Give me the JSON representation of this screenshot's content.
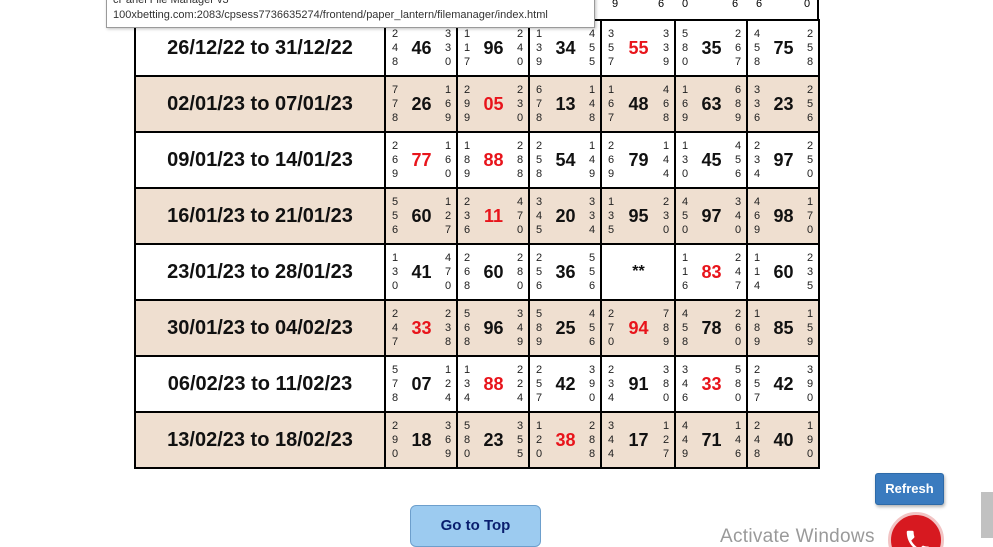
{
  "tooltip": {
    "title": "cPanel File Manager v3",
    "url": "100xbetting.com:2083/cpsess7736635274/frontend/paper_lantern/filemanager/index.html"
  },
  "top_partial": [
    "9",
    "6",
    "0",
    "6",
    "6",
    "0"
  ],
  "rows": [
    {
      "date": "26/12/22 to 31/12/22",
      "cells": [
        {
          "l": [
            "2",
            "4",
            "8"
          ],
          "j": "46",
          "r": [
            "3",
            "3",
            "0"
          ],
          "red": false
        },
        {
          "l": [
            "1",
            "1",
            "7"
          ],
          "j": "96",
          "r": [
            "2",
            "4",
            "0"
          ],
          "red": false
        },
        {
          "l": [
            "1",
            "3",
            "9"
          ],
          "j": "34",
          "r": [
            "4",
            "5",
            "5"
          ],
          "red": false
        },
        {
          "l": [
            "3",
            "5",
            "7"
          ],
          "j": "55",
          "r": [
            "3",
            "3",
            "9"
          ],
          "red": true
        },
        {
          "l": [
            "5",
            "8",
            "0"
          ],
          "j": "35",
          "r": [
            "2",
            "6",
            "7"
          ],
          "red": false
        },
        {
          "l": [
            "4",
            "5",
            "8"
          ],
          "j": "75",
          "r": [
            "2",
            "5",
            "8"
          ],
          "red": false
        }
      ]
    },
    {
      "date": "02/01/23 to 07/01/23",
      "cells": [
        {
          "l": [
            "7",
            "7",
            "8"
          ],
          "j": "26",
          "r": [
            "1",
            "6",
            "9"
          ],
          "red": false
        },
        {
          "l": [
            "2",
            "9",
            "9"
          ],
          "j": "05",
          "r": [
            "2",
            "3",
            "0"
          ],
          "red": true
        },
        {
          "l": [
            "6",
            "7",
            "8"
          ],
          "j": "13",
          "r": [
            "1",
            "4",
            "8"
          ],
          "red": false
        },
        {
          "l": [
            "1",
            "6",
            "7"
          ],
          "j": "48",
          "r": [
            "4",
            "6",
            "8"
          ],
          "red": false
        },
        {
          "l": [
            "1",
            "6",
            "9"
          ],
          "j": "63",
          "r": [
            "6",
            "8",
            "9"
          ],
          "red": false
        },
        {
          "l": [
            "3",
            "3",
            "6"
          ],
          "j": "23",
          "r": [
            "2",
            "5",
            "6"
          ],
          "red": false
        }
      ]
    },
    {
      "date": "09/01/23 to 14/01/23",
      "cells": [
        {
          "l": [
            "2",
            "6",
            "9"
          ],
          "j": "77",
          "r": [
            "1",
            "6",
            "0"
          ],
          "red": true
        },
        {
          "l": [
            "1",
            "8",
            "9"
          ],
          "j": "88",
          "r": [
            "2",
            "8",
            "8"
          ],
          "red": true
        },
        {
          "l": [
            "2",
            "5",
            "8"
          ],
          "j": "54",
          "r": [
            "1",
            "4",
            "9"
          ],
          "red": false
        },
        {
          "l": [
            "2",
            "6",
            "9"
          ],
          "j": "79",
          "r": [
            "1",
            "4",
            "4"
          ],
          "red": false
        },
        {
          "l": [
            "1",
            "3",
            "0"
          ],
          "j": "45",
          "r": [
            "4",
            "5",
            "6"
          ],
          "red": false
        },
        {
          "l": [
            "2",
            "3",
            "4"
          ],
          "j": "97",
          "r": [
            "2",
            "5",
            "0"
          ],
          "red": false
        }
      ]
    },
    {
      "date": "16/01/23 to 21/01/23",
      "cells": [
        {
          "l": [
            "5",
            "5",
            "6"
          ],
          "j": "60",
          "r": [
            "1",
            "2",
            "7"
          ],
          "red": false
        },
        {
          "l": [
            "2",
            "3",
            "6"
          ],
          "j": "11",
          "r": [
            "4",
            "7",
            "0"
          ],
          "red": true
        },
        {
          "l": [
            "3",
            "4",
            "5"
          ],
          "j": "20",
          "r": [
            "3",
            "3",
            "4"
          ],
          "red": false
        },
        {
          "l": [
            "1",
            "3",
            "5"
          ],
          "j": "95",
          "r": [
            "2",
            "3",
            "0"
          ],
          "red": false
        },
        {
          "l": [
            "4",
            "5",
            "0"
          ],
          "j": "97",
          "r": [
            "3",
            "4",
            "0"
          ],
          "red": false
        },
        {
          "l": [
            "4",
            "6",
            "9"
          ],
          "j": "98",
          "r": [
            "1",
            "7",
            "0"
          ],
          "red": false
        }
      ]
    },
    {
      "date": "23/01/23 to 28/01/23",
      "cells": [
        {
          "l": [
            "1",
            "3",
            "0"
          ],
          "j": "41",
          "r": [
            "4",
            "7",
            "0"
          ],
          "red": false
        },
        {
          "l": [
            "2",
            "6",
            "8"
          ],
          "j": "60",
          "r": [
            "2",
            "8",
            "0"
          ],
          "red": false
        },
        {
          "l": [
            "2",
            "5",
            "6"
          ],
          "j": "36",
          "r": [
            "5",
            "5",
            "6"
          ],
          "red": false
        },
        {
          "stars": "**"
        },
        {
          "l": [
            "1",
            "1",
            "6"
          ],
          "j": "83",
          "r": [
            "2",
            "4",
            "7"
          ],
          "red": true
        },
        {
          "l": [
            "1",
            "1",
            "4"
          ],
          "j": "60",
          "r": [
            "2",
            "3",
            "5"
          ],
          "red": false
        }
      ]
    },
    {
      "date": "30/01/23 to 04/02/23",
      "cells": [
        {
          "l": [
            "2",
            "4",
            "7"
          ],
          "j": "33",
          "r": [
            "2",
            "3",
            "8"
          ],
          "red": true
        },
        {
          "l": [
            "5",
            "6",
            "8"
          ],
          "j": "96",
          "r": [
            "3",
            "4",
            "9"
          ],
          "red": false
        },
        {
          "l": [
            "5",
            "8",
            "9"
          ],
          "j": "25",
          "r": [
            "4",
            "5",
            "6"
          ],
          "red": false
        },
        {
          "l": [
            "2",
            "7",
            "0"
          ],
          "j": "94",
          "r": [
            "7",
            "8",
            "9"
          ],
          "red": true
        },
        {
          "l": [
            "4",
            "5",
            "8"
          ],
          "j": "78",
          "r": [
            "2",
            "6",
            "0"
          ],
          "red": false
        },
        {
          "l": [
            "1",
            "8",
            "9"
          ],
          "j": "85",
          "r": [
            "1",
            "5",
            "9"
          ],
          "red": false
        }
      ]
    },
    {
      "date": "06/02/23 to 11/02/23",
      "cells": [
        {
          "l": [
            "5",
            "7",
            "8"
          ],
          "j": "07",
          "r": [
            "1",
            "2",
            "4"
          ],
          "red": false
        },
        {
          "l": [
            "1",
            "3",
            "4"
          ],
          "j": "88",
          "r": [
            "2",
            "2",
            "4"
          ],
          "red": true
        },
        {
          "l": [
            "2",
            "5",
            "7"
          ],
          "j": "42",
          "r": [
            "3",
            "9",
            "0"
          ],
          "red": false
        },
        {
          "l": [
            "2",
            "3",
            "4"
          ],
          "j": "91",
          "r": [
            "3",
            "8",
            "0"
          ],
          "red": false
        },
        {
          "l": [
            "3",
            "4",
            "6"
          ],
          "j": "33",
          "r": [
            "5",
            "8",
            "0"
          ],
          "red": true
        },
        {
          "l": [
            "2",
            "5",
            "7"
          ],
          "j": "42",
          "r": [
            "3",
            "9",
            "0"
          ],
          "red": false
        }
      ]
    },
    {
      "date": "13/02/23 to 18/02/23",
      "cells": [
        {
          "l": [
            "2",
            "9",
            "0"
          ],
          "j": "18",
          "r": [
            "3",
            "6",
            "9"
          ],
          "red": false
        },
        {
          "l": [
            "5",
            "8",
            "0"
          ],
          "j": "23",
          "r": [
            "3",
            "5",
            "5"
          ],
          "red": false
        },
        {
          "l": [
            "1",
            "2",
            "0"
          ],
          "j": "38",
          "r": [
            "2",
            "8",
            "8"
          ],
          "red": true
        },
        {
          "l": [
            "3",
            "4",
            "4"
          ],
          "j": "17",
          "r": [
            "1",
            "2",
            "7"
          ],
          "red": false
        },
        {
          "l": [
            "4",
            "4",
            "9"
          ],
          "j": "71",
          "r": [
            "1",
            "4",
            "6"
          ],
          "red": false
        },
        {
          "l": [
            "2",
            "4",
            "8"
          ],
          "j": "40",
          "r": [
            "1",
            "9",
            "0"
          ],
          "red": false
        }
      ]
    }
  ],
  "buttons": {
    "refresh": "Refresh",
    "go_to_top": "Go to Top"
  },
  "watermark": "Activate Windows",
  "icons": {
    "call": "phone-icon"
  },
  "colors": {
    "row_alt": "#efdfd0",
    "red_number": "#e8141b",
    "refresh_bg": "#3a7bbf",
    "top_bg": "#9ccbf0",
    "call_bg": "#d71920"
  }
}
